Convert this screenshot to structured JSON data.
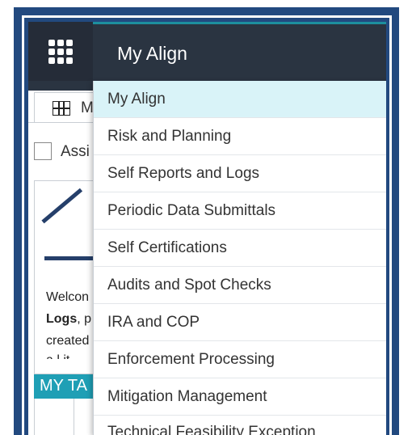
{
  "header": {
    "app_menu_icon": "grid-waffle-icon",
    "title": "My Align"
  },
  "background": {
    "tab_label": "M",
    "tab_icon": "table-grid-icon",
    "assign_label": "Assi",
    "welcome_line1": "Welcon",
    "welcome_line2_bold": "Logs",
    "welcome_line2_rest": ", p",
    "welcome_line3": "created",
    "welcome_line4": "a  l  it",
    "my_tasks_label": "MY TA"
  },
  "menu": {
    "items": [
      {
        "label": "My Align",
        "active": true
      },
      {
        "label": "Risk and Planning",
        "active": false
      },
      {
        "label": "Self Reports and Logs",
        "active": false
      },
      {
        "label": "Periodic Data Submittals",
        "active": false
      },
      {
        "label": "Self Certifications",
        "active": false
      },
      {
        "label": "Audits and Spot Checks",
        "active": false
      },
      {
        "label": "IRA and COP",
        "active": false
      },
      {
        "label": "Enforcement Processing",
        "active": false
      },
      {
        "label": "Mitigation Management",
        "active": false
      },
      {
        "label": "Technical Feasibility Exception",
        "active": false
      }
    ]
  },
  "colors": {
    "frame_blue": "#22497f",
    "header_dark": "#2a3441",
    "accent_teal": "#1d8f9e",
    "my_tasks_bar": "#1f9fb5",
    "active_item_bg": "#d9f3f8"
  }
}
